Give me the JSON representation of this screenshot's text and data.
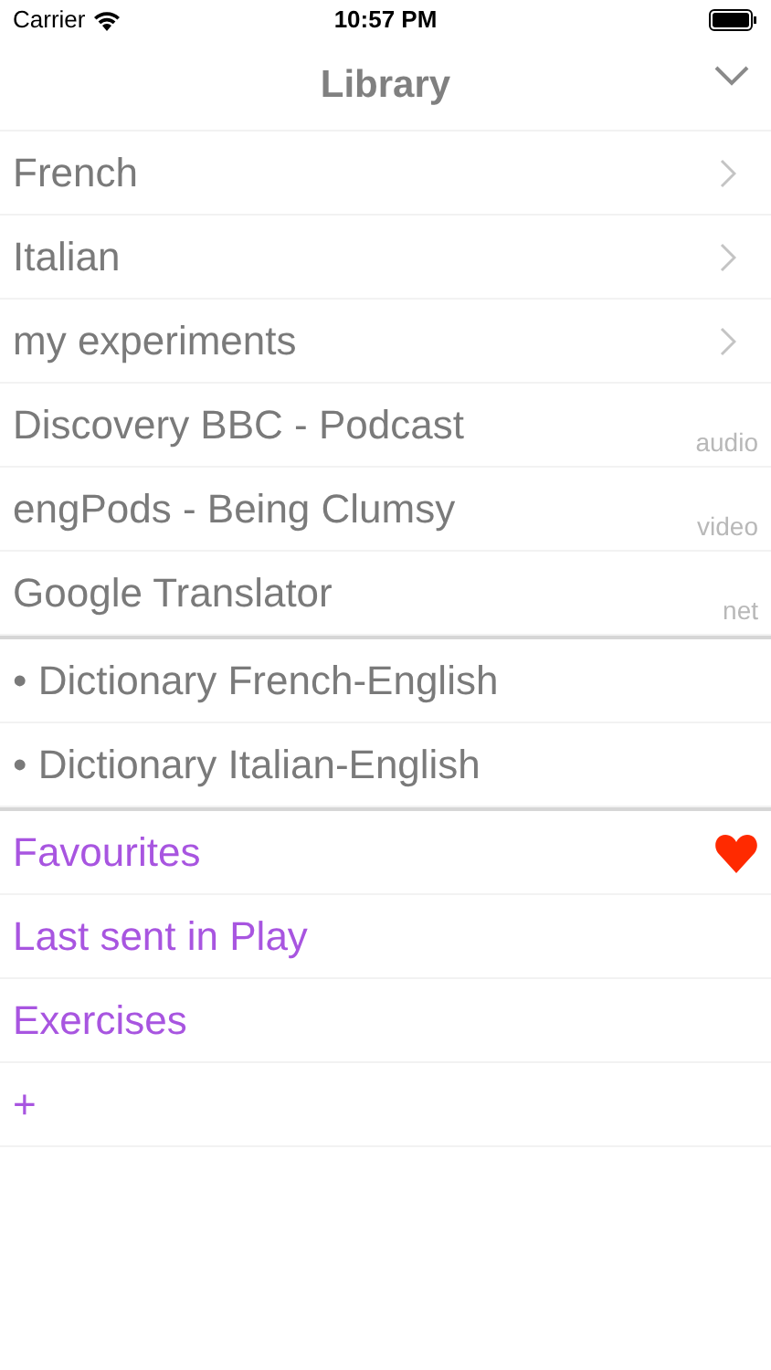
{
  "status_bar": {
    "carrier": "Carrier",
    "time": "10:57 PM"
  },
  "nav": {
    "title": "Library"
  },
  "sections": [
    {
      "items": [
        {
          "kind": "folder",
          "label": "French"
        },
        {
          "kind": "folder",
          "label": "Italian"
        },
        {
          "kind": "folder",
          "label": "my experiments"
        },
        {
          "kind": "feed",
          "label": "Discovery BBC - Podcast",
          "tag": "audio"
        },
        {
          "kind": "feed",
          "label": "engPods - Being Clumsy",
          "tag": "video"
        },
        {
          "kind": "feed",
          "label": "Google Translator",
          "tag": "net"
        }
      ]
    },
    {
      "items": [
        {
          "kind": "plain",
          "label": "• Dictionary French-English"
        },
        {
          "kind": "plain",
          "label": "• Dictionary Italian-English"
        }
      ]
    },
    {
      "items": [
        {
          "kind": "favourite",
          "label": "Favourites"
        },
        {
          "kind": "special",
          "label": "Last sent in Play"
        },
        {
          "kind": "special",
          "label": "Exercises"
        },
        {
          "kind": "special",
          "label": "+"
        }
      ]
    }
  ]
}
